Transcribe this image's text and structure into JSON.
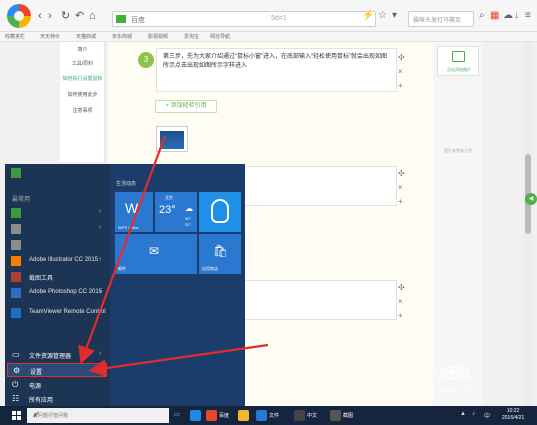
{
  "browser": {
    "address_prefix": "百度",
    "address_suffix": "5d=1",
    "search_placeholder": "猫咪头发打马赛克",
    "bookmarks": [
      "收藏夹栏",
      "天天特价",
      "天猫商城",
      "京东商城",
      "影视视频",
      "爱淘宝",
      "网址导航"
    ]
  },
  "left_nav": {
    "items": [
      "简介",
      "工具/原料",
      "如何执行设置鼠标",
      "如何使用此步",
      "注意事项"
    ]
  },
  "editor": {
    "step3_number": "3",
    "step3_text": "第三步，先为大家介绍通过“鼠标小窗”进入，在底部输入“轻松使用鼠标”就会出现如图所示点击出现如图所示字样进入",
    "add_button": "+ 添加经验引用",
    "controls": {
      "move": "✣",
      "close": "×",
      "add": "+"
    }
  },
  "right_panel": {
    "card_label": "点击添加图片",
    "small_label": "图片未完成上传"
  },
  "start_menu": {
    "most_used_heading": "最常用",
    "apps": [
      {
        "label": "",
        "color": "#3a9a3a"
      },
      {
        "label": "",
        "color": "#8c8c8c"
      },
      {
        "label": "",
        "color": "#8c8c8c"
      },
      {
        "label": "Adobe Illustrator CC 2015",
        "color": "#ff7c00"
      },
      {
        "label": "截图工具",
        "color": "#b04030"
      },
      {
        "label": "Adobe Photoshop CC 2015",
        "color": "#2d6fc0"
      },
      {
        "label": "TeamViewer Remote Control",
        "color": "#1e6fc8"
      }
    ],
    "bottom": [
      {
        "glyph": "▭",
        "label": "文件资源管理器"
      },
      {
        "glyph": "⚙",
        "label": "设置"
      },
      {
        "glyph": "⏻",
        "label": "电源"
      },
      {
        "glyph": "☷",
        "label": "所有应用"
      }
    ],
    "tiles_heading": "生活动态",
    "tiles": {
      "mail_label": "WPS Office",
      "weather_city": "北京",
      "weather_temp": "23°",
      "weather_hi": "30°",
      "weather_lo": "22°",
      "qq_label": "",
      "mail2_label": "邮件",
      "store_label": "应用商店"
    }
  },
  "taskbar": {
    "search_placeholder": "有问题尽管问我",
    "app_labels": [
      "百度",
      "文件",
      "中文",
      "截图"
    ],
    "time": "10:22",
    "date": "2016/4/21"
  },
  "watermark": {
    "text": "Bai©经验",
    "url": "jingyan.baidu.com"
  }
}
